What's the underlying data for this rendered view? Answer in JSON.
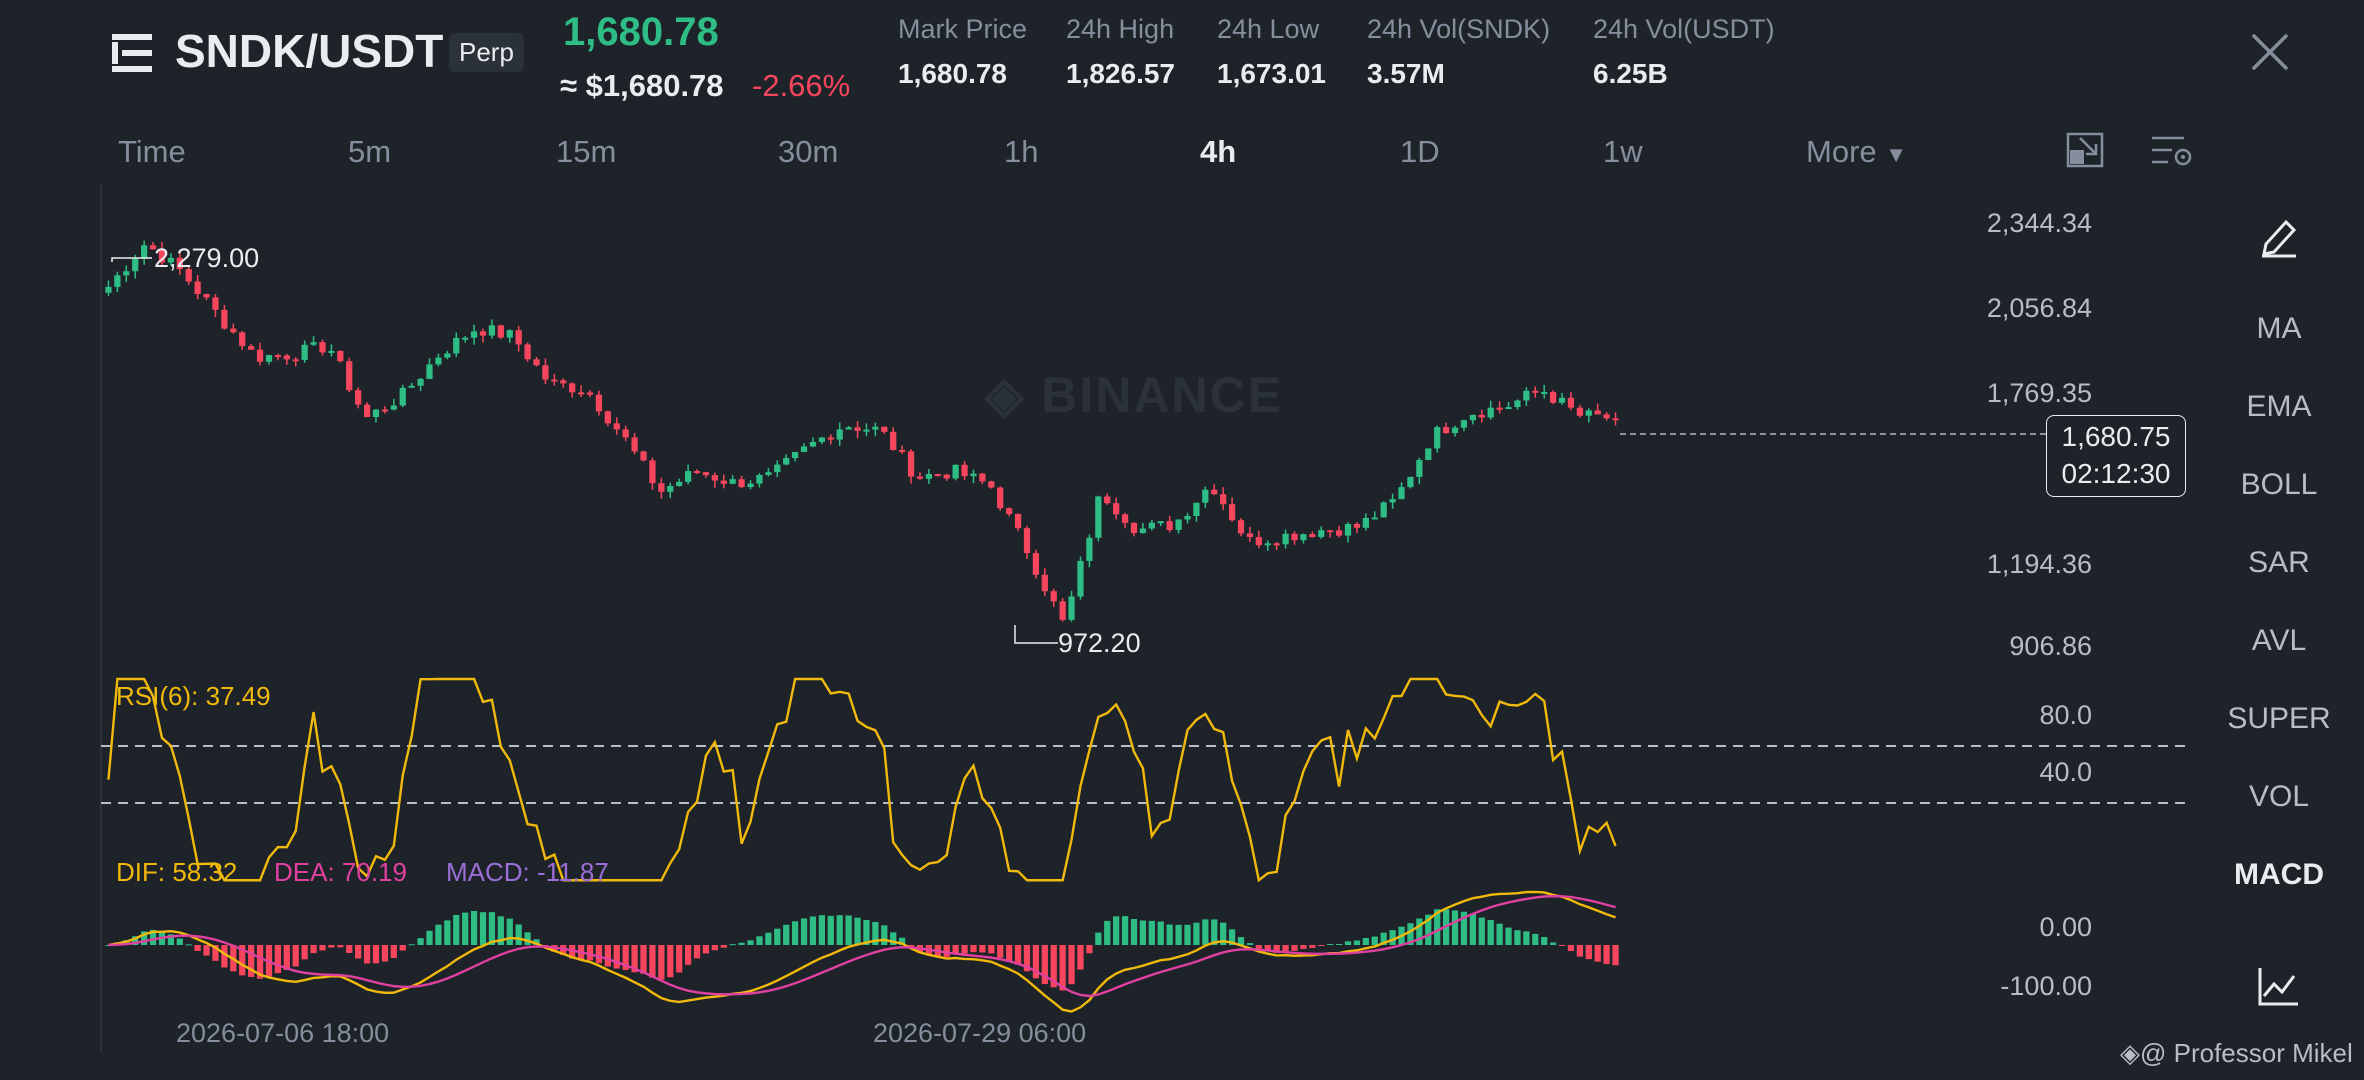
{
  "header": {
    "pair": "SNDK/USDT",
    "contract_badge": "Perp",
    "last_price": "1,680.78",
    "usd_price": "≈ $1,680.78",
    "change_pct": "-2.66%",
    "stats": [
      {
        "label": "Mark Price",
        "value": "1,680.78"
      },
      {
        "label": "24h High",
        "value": "1,826.57"
      },
      {
        "label": "24h Low",
        "value": "1,673.01"
      },
      {
        "label": "24h Vol(SNDK)",
        "value": "3.57M"
      },
      {
        "label": "24h Vol(USDT)",
        "value": "6.25B"
      }
    ]
  },
  "timeframes": {
    "items": [
      "Time",
      "5m",
      "15m",
      "30m",
      "1h",
      "4h",
      "1D",
      "1w",
      "More"
    ],
    "active": "4h"
  },
  "sidebar": {
    "items": [
      "MA",
      "EMA",
      "BOLL",
      "SAR",
      "AVL",
      "SUPER",
      "VOL",
      "MACD"
    ],
    "active": "MACD"
  },
  "chart": {
    "watermark": "BINANCE",
    "price_axis": [
      "2,344.34",
      "2,056.84",
      "1,769.35",
      "1,194.36",
      "906.86"
    ],
    "current_price": "1,680.75",
    "countdown": "02:12:30",
    "high_label": "2,279.00",
    "low_label": "972.20",
    "rsi": {
      "label": "RSI(6): 37.49",
      "axis": [
        "80.0",
        "40.0"
      ]
    },
    "macd": {
      "dif": "DIF: 58.32",
      "dea": "DEA: 70.19",
      "macd": "MACD: -11.87",
      "axis": [
        "0.00",
        "-100.00"
      ]
    },
    "dates": [
      "2026-07-06 18:00",
      "2026-07-29 06:00"
    ],
    "colors": {
      "up": "#2ebd85",
      "down": "#f6465d",
      "rsi": "#f0b90b",
      "dif": "#f0b90b",
      "dea": "#e040a0",
      "macd": "#9b6dd6"
    }
  },
  "chart_data": {
    "type": "line",
    "title": "SNDK/USDT",
    "xlabel": "",
    "ylabel": "",
    "ylim": [
      906.86,
      2344.34
    ],
    "x": [
      "2026-07-06 18:00",
      "2026-07-29 06:00"
    ],
    "series": [
      {
        "name": "",
        "values": [
          2130,
          2279,
          2180,
          2030,
          1890,
          1900,
          1930,
          1680,
          1760,
          1900,
          1990,
          1960,
          1800,
          1780,
          1620,
          1430,
          1500,
          1460,
          1480,
          1580,
          1660,
          1640,
          1480,
          1500,
          1450,
          1230,
          972.2,
          1430,
          1300,
          1320,
          1460,
          1260,
          1280,
          1300,
          1310,
          1400,
          1620,
          1700,
          1720,
          1780,
          1690,
          1680.75
        ]
      }
    ]
  },
  "credit": "@ Professor Mikel"
}
